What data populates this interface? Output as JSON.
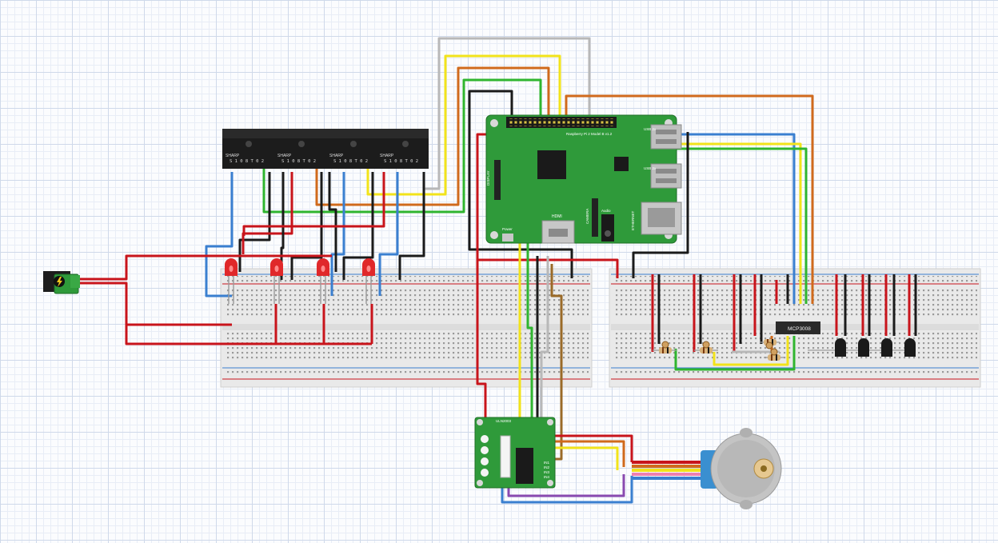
{
  "colors": {
    "red_wire": "#c8141b",
    "black_wire": "#1a1a1a",
    "blue_wire": "#3a7fd0",
    "green_wire": "#2fb52f",
    "yellow_wire": "#f2e31a",
    "orange_wire": "#d06a1c",
    "white_wire": "#b8b8b8",
    "purple_wire": "#8a4ab0",
    "brown_wire": "#9a6a28",
    "pcb_green": "#2f9a3a",
    "breadboard": "#e9e9e9"
  },
  "pi": {
    "model": "Raspberry Pi 2 Model B v1.2",
    "power": "Power",
    "hdmi": "HDMI",
    "audio": "Audio",
    "ethernet": "ETHERNET",
    "usb1": "USB 2x",
    "usb2": "USB 2x",
    "display": "DISPLAY",
    "camera": "CAMERA"
  },
  "sensors": [
    {
      "brand": "SHARP",
      "model": "S 1 0 8 T 0 2"
    },
    {
      "brand": "SHARP",
      "model": "S 1 0 8 T 0 2"
    },
    {
      "brand": "SHARP",
      "model": "S 1 0 8 T 0 2"
    },
    {
      "brand": "SHARP",
      "model": "S 1 0 8 T 0 2"
    }
  ],
  "adc": {
    "label": "MCP3008"
  },
  "driver": {
    "label": "ULN2003",
    "inputs": [
      "IN1",
      "IN2",
      "IN3",
      "IN4"
    ]
  },
  "power_jack": {
    "icon": "lightning-icon"
  },
  "leds": 4,
  "ldrs": 4,
  "transistors": 4,
  "stepper": {
    "icon": "stepper-motor-icon"
  }
}
